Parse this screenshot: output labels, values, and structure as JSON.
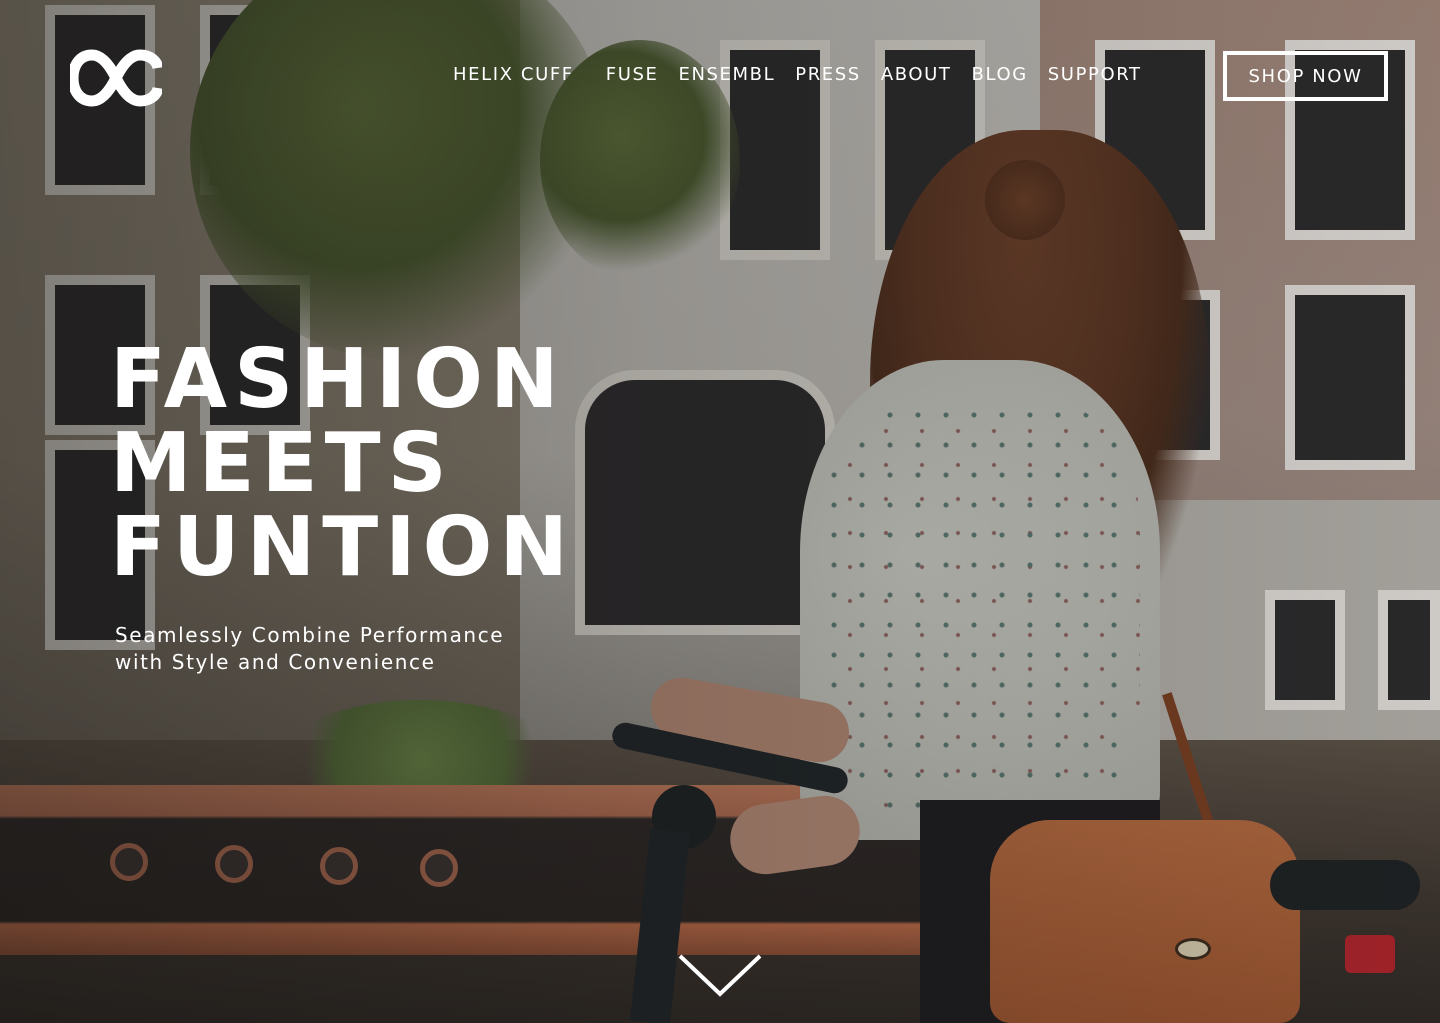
{
  "brand": {
    "logo_icon": "oc-logo-icon"
  },
  "nav": {
    "items": [
      {
        "label": "HELIX CUFF"
      },
      {
        "label": "FUSE"
      },
      {
        "label": "ENSEMBL"
      },
      {
        "label": "PRESS"
      },
      {
        "label": "ABOUT"
      },
      {
        "label": "BLOG"
      },
      {
        "label": "SUPPORT"
      }
    ],
    "cta_label": "SHOP NOW"
  },
  "hero": {
    "headline_lines": [
      "FASHION",
      "MEETS",
      "FUNTION"
    ],
    "subline_lines": [
      "Seamlessly Combine Performance",
      "with Style and Convenience"
    ],
    "scroll_icon": "chevron-down-icon"
  },
  "colors": {
    "text": "#ffffff",
    "overlay": "#141210"
  }
}
